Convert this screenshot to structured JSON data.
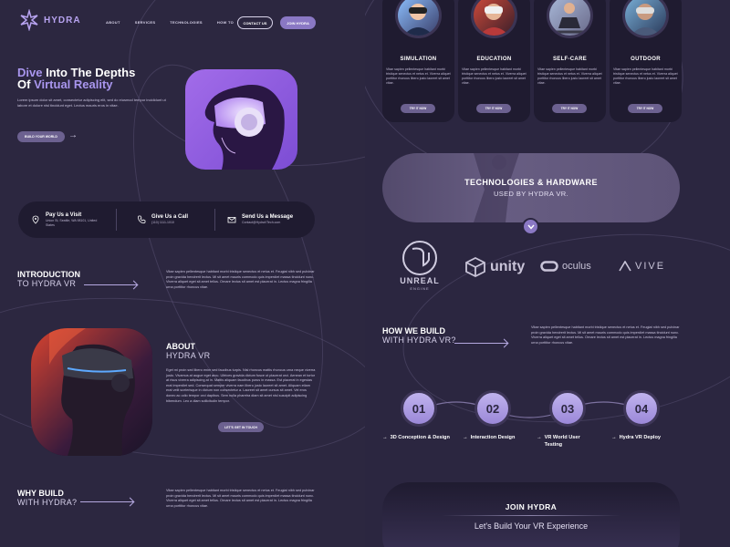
{
  "nav": {
    "brand": "HYDRA",
    "links": [
      "ABOUT",
      "SERVICES",
      "TECHNOLOGIES",
      "HOW TO"
    ],
    "contact_label": "CONTACT US",
    "join_label": "JOIN HYDRA"
  },
  "hero": {
    "title_line1_accent": "Dive",
    "title_line1_rest": " Into The Depths",
    "title_line2_rest": "Of ",
    "title_line2_accent": "Virtual Reality",
    "description": "Lorem ipsum dolor sit amet, consectetur adipiscing elit, sed do eiusmod tempor incididunt ut labore et dolore nisl tincidunt eget. Lectus mauris eros in vitae.",
    "button": "BUILD YOUR WORLD"
  },
  "contact": [
    {
      "title": "Pay Us a Visit",
      "sub": "Union St, Seattle, WA 98101, United States",
      "icon": "map-pin-icon"
    },
    {
      "title": "Give Us a Call",
      "sub": "(110) 1111-1010",
      "icon": "phone-icon"
    },
    {
      "title": "Send Us a Message",
      "sub": "Contact@HydraVTech.com",
      "icon": "mail-icon"
    }
  ],
  "intro": {
    "line1": "INTRODUCTION",
    "line2": "TO HYDRA VR",
    "text": "Vitae sapien pellentesque habitant morbi tristique senectus et netus et. Feugiat nibh sed pulvinar proin gravida hendrerit lectus. Mi sit amet mauris commodo quis imperdiet massa tincidunt nunc. Viverra aliquet eget sit amet tellus. Ornare lectus sit amet est placerat in. Lectus magna fringilla urna porttitor rhoncus vitae."
  },
  "about": {
    "line1": "ABOUT",
    "line2": "HYDRA VR",
    "text": "Eget mi proin sed libero enim sed faucibus turpis. Nisl rhoncus mattis rhoncus urna neque viverra justo. Vivamus at augue eget arcu. Ultrices gravida dictum fusce ut placerat orci. Aenean et tortor at risus viverra adipiscing at in. Mattis aliquam faucibus purus in massa. Est placerat in egestas erat imperdiet sed. Consequat semper viverra nam libero justo laoreet sit amet. Aliquam etiam erat velit scelerisque in dictum non consectetur a. Laoreet sit amet cursus sit amet. Vel eros donec ac odio tempor orci dapibus. Sem nulla pharetra diam sit amet nisl suscipit adipiscing bibendum. Leo a diam sollicitudin tempor.",
    "button": "LET'S GET IN TOUCH"
  },
  "why": {
    "line1": "WHY BUILD",
    "line2": "WITH HYDRA?",
    "text": "Vitae sapien pellentesque habitant morbi tristique senectus et netus et. Feugiat nibh sed pulvinar proin gravida hendrerit lectus. Mi sit amet mauris commodo quis imperdiet massa tincidunt nunc. Viverra aliquet eget sit amet tellus. Ornare lectus sit amet est placerat in. Lectus magna fringilla urna porttitor rhoncus vitae."
  },
  "cards": [
    {
      "title": "SIMULATION",
      "desc": "Vitae sapien pellentesque habitant morbi tristique senectus et netus et. Viverra aliquet porttitor rhoncus libero justo laoreet sit amet vitae.",
      "button": "TRY IT NOW"
    },
    {
      "title": "EDUCATION",
      "desc": "Vitae sapien pellentesque habitant morbi tristique senectus et netus et. Viverra aliquet porttitor rhoncus libero justo laoreet sit amet vitae.",
      "button": "TRY IT NOW"
    },
    {
      "title": "SELF-CARE",
      "desc": "Vitae sapien pellentesque habitant morbi tristique senectus et netus et. Viverra aliquet porttitor rhoncus libero justo laoreet sit amet vitae.",
      "button": "TRY IT NOW"
    },
    {
      "title": "OUTDOOR",
      "desc": "Vitae sapien pellentesque habitant morbi tristique senectus et netus et. Viverra aliquet porttitor rhoncus libero justo laoreet sit amet vitae.",
      "button": "TRY IT NOW"
    }
  ],
  "tech": {
    "title": "TECHNOLOGIES & HARDWARE",
    "subtitle": "USED BY HYDRA VR.",
    "logos": {
      "unreal_line1": "UNREAL",
      "unreal_line2": "ENGINE",
      "unity": "unity",
      "oculus": "oculus",
      "vive": "VIVE"
    }
  },
  "how": {
    "line1": "HOW WE BUILD",
    "line2": "WITH HYDRA VR?",
    "text": "Vitae sapien pellentesque habitant morbi tristique senectus et netus et. Feugiat nibh sed pulvinar proin gravida hendrerit lectus. Mi sit amet mauris commodo quis imperdiet massa tincidunt nunc. Viverra aliquet eget sit amet tellus. Ornare lectus sit amet est placerat in. Lectus magna fringilla urna porttitor rhoncus vitae.",
    "steps": [
      {
        "num": "01",
        "label": "3D Conception & Design"
      },
      {
        "num": "02",
        "label": "Interaction Design"
      },
      {
        "num": "03",
        "label": "VR World User Testing"
      },
      {
        "num": "04",
        "label": "Hydra VR Deploy"
      }
    ]
  },
  "join": {
    "title": "JOIN HYDRA",
    "subtitle": "Let's Build Your VR Experience"
  },
  "colors": {
    "accent": "#a996ee",
    "background": "#2f2a42",
    "panel": "#1f1b30",
    "button": "#6c6190"
  }
}
